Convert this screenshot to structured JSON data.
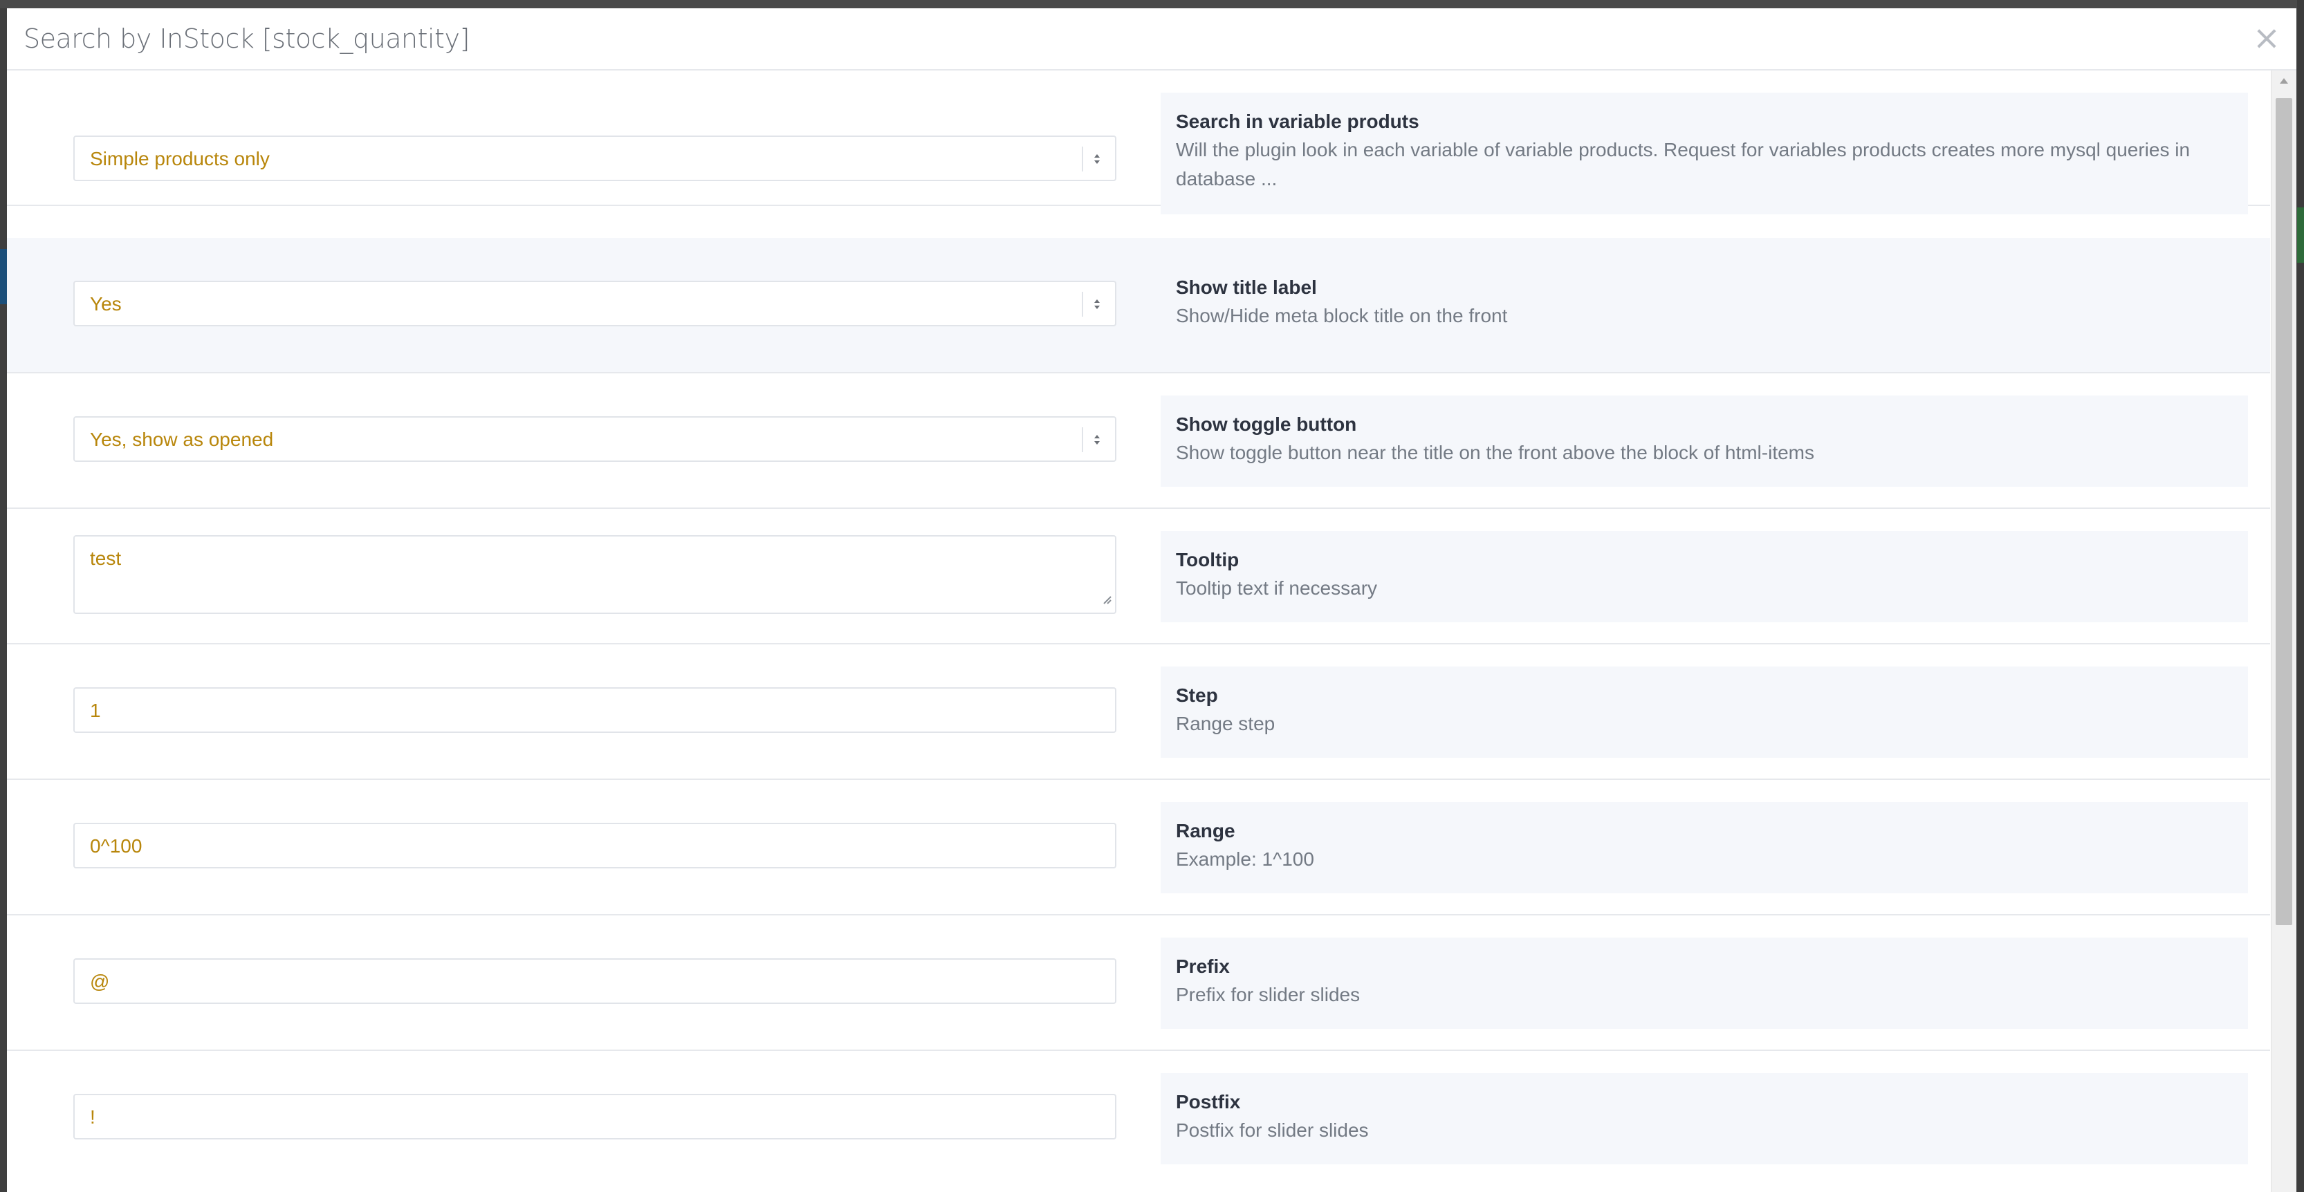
{
  "modal": {
    "title": "Search by InStock [stock_quantity]",
    "close_symbol": "×"
  },
  "rows": [
    {
      "type": "select",
      "value": "Simple products only",
      "title": "Search in variable produts",
      "desc": "Will the plugin look in each variable of variable products. Request for variables products creates more mysql queries in database ..."
    },
    {
      "type": "select",
      "value": "Yes",
      "title": "Show title label",
      "desc": "Show/Hide meta block title on the front"
    },
    {
      "type": "select",
      "value": "Yes, show as opened",
      "title": "Show toggle button",
      "desc": "Show toggle button near the title on the front above the block of html-items"
    },
    {
      "type": "textarea",
      "value": "test",
      "title": "Tooltip",
      "desc": "Tooltip text if necessary"
    },
    {
      "type": "input",
      "value": "1",
      "title": "Step",
      "desc": "Range step"
    },
    {
      "type": "input",
      "value": "0^100",
      "title": "Range",
      "desc": "Example: 1^100"
    },
    {
      "type": "input",
      "value": "@",
      "title": "Prefix",
      "desc": "Prefix for slider slides"
    },
    {
      "type": "input",
      "value": "!",
      "title": "Postfix",
      "desc": "Postfix for slider slides"
    }
  ],
  "colors": {
    "field_text": "#b8860b",
    "info_bg": "#f5f7fb",
    "title_text": "#2d3340",
    "desc_text": "#737a84"
  }
}
